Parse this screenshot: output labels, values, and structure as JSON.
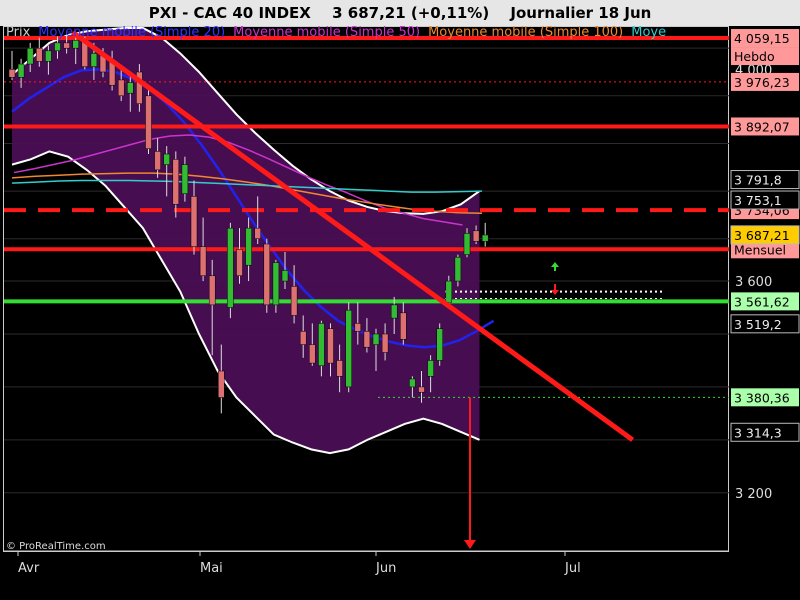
{
  "header": {
    "symbol": "PXI - CAC 40 INDEX",
    "last": "3 687,21 (+0,11%)",
    "period": "Journalier 18 Jun"
  },
  "legend": {
    "items": [
      {
        "label": "Prix",
        "color": "#cccccc"
      },
      {
        "label": "Moyenne mobile (Simple 20)",
        "color": "#3333ff"
      },
      {
        "label": "Moyenne mobile (Simple 50)",
        "color": "#cc33cc"
      },
      {
        "label": "Moyenne mobile (Simple 100)",
        "color": "#ee8833"
      },
      {
        "label": "Moye",
        "color": "#33cccc"
      }
    ]
  },
  "watermark": "© ProRealTime.com",
  "colors": {
    "up": "#33bb33",
    "down": "#dd7070",
    "band_fill": "#4a0f55",
    "mm20": "#2222ee",
    "mm50": "#cc33cc",
    "mm100": "#ee8833",
    "mm200": "#33cccc",
    "resistance": "#ff1a1a",
    "support": "#33dd33"
  },
  "chart_data": {
    "type": "candlestick",
    "title": "PXI - CAC 40 INDEX",
    "x_tick_labels": [
      {
        "label": "Avr",
        "index": 0
      },
      {
        "label": "Mai",
        "index": 20
      },
      {
        "label": "Jun",
        "index": 40
      },
      {
        "label": "Jul",
        "index": 61
      }
    ],
    "y_tick_labels": [
      3200,
      3600,
      4000
    ],
    "ylim": [
      3090,
      4080
    ],
    "ohlc": [
      [
        4000,
        4035,
        3980,
        3985
      ],
      [
        3985,
        4020,
        3965,
        4010
      ],
      [
        4010,
        4050,
        3995,
        4040
      ],
      [
        4040,
        4060,
        4005,
        4015
      ],
      [
        4015,
        4045,
        3990,
        4035
      ],
      [
        4035,
        4062,
        4020,
        4050
      ],
      [
        4050,
        4066,
        4030,
        4040
      ],
      [
        4040,
        4060,
        4010,
        4055
      ],
      [
        4055,
        4062,
        4000,
        4005
      ],
      [
        4005,
        4050,
        3980,
        4030
      ],
      [
        4030,
        4040,
        3985,
        3995
      ],
      [
        4015,
        4035,
        3960,
        3970
      ],
      [
        3980,
        4000,
        3940,
        3950
      ],
      [
        3955,
        3990,
        3920,
        3975
      ],
      [
        3995,
        4010,
        3920,
        3935
      ],
      [
        3950,
        3965,
        3840,
        3850
      ],
      [
        3845,
        3870,
        3795,
        3810
      ],
      [
        3820,
        3855,
        3760,
        3840
      ],
      [
        3830,
        3845,
        3720,
        3745
      ],
      [
        3765,
        3835,
        3750,
        3820
      ],
      [
        3760,
        3790,
        3650,
        3665
      ],
      [
        3665,
        3720,
        3600,
        3610
      ],
      [
        3610,
        3640,
        3460,
        3555
      ],
      [
        3430,
        3480,
        3350,
        3380
      ],
      [
        3550,
        3710,
        3530,
        3700
      ],
      [
        3660,
        3700,
        3595,
        3610
      ],
      [
        3630,
        3720,
        3600,
        3700
      ],
      [
        3700,
        3760,
        3670,
        3680
      ],
      [
        3670,
        3680,
        3540,
        3555
      ],
      [
        3555,
        3640,
        3540,
        3635
      ],
      [
        3600,
        3655,
        3585,
        3620
      ],
      [
        3590,
        3630,
        3520,
        3535
      ],
      [
        3505,
        3535,
        3455,
        3480
      ],
      [
        3480,
        3520,
        3440,
        3445
      ],
      [
        3440,
        3525,
        3420,
        3520
      ],
      [
        3510,
        3520,
        3420,
        3445
      ],
      [
        3450,
        3480,
        3390,
        3420
      ],
      [
        3400,
        3560,
        3390,
        3545
      ],
      [
        3520,
        3560,
        3480,
        3505
      ],
      [
        3505,
        3530,
        3465,
        3475
      ],
      [
        3480,
        3510,
        3430,
        3500
      ],
      [
        3500,
        3520,
        3450,
        3465
      ],
      [
        3530,
        3570,
        3500,
        3555
      ],
      [
        3540,
        3560,
        3480,
        3490
      ],
      [
        3400,
        3420,
        3380,
        3415
      ],
      [
        3400,
        3430,
        3370,
        3390
      ],
      [
        3420,
        3460,
        3390,
        3450
      ],
      [
        3450,
        3520,
        3440,
        3510
      ],
      [
        3560,
        3610,
        3550,
        3600
      ],
      [
        3600,
        3650,
        3590,
        3645
      ],
      [
        3650,
        3700,
        3645,
        3690
      ],
      [
        3695,
        3705,
        3670,
        3675
      ],
      [
        3675,
        3710,
        3665,
        3687
      ]
    ],
    "moving_averages": {
      "Moyenne mobile (Simple 20)": [
        3920,
        3945,
        3965,
        3985,
        3998,
        4000,
        3995,
        3982,
        3962,
        3935,
        3900,
        3858,
        3812,
        3762,
        3712,
        3665,
        3620,
        3582,
        3550,
        3524,
        3508,
        3495,
        3485,
        3478,
        3475,
        3478,
        3488,
        3505,
        3525
      ],
      "Moyenne mobile (Simple 50)": [
        3805,
        3812,
        3820,
        3828,
        3838,
        3848,
        3858,
        3868,
        3874,
        3876,
        3872,
        3862,
        3848,
        3832,
        3815,
        3798,
        3782,
        3768,
        3752,
        3738,
        3728,
        3718,
        3712,
        3706
      ],
      "Moyenne mobile (Simple 100)": [
        3795,
        3798,
        3800,
        3802,
        3803,
        3804,
        3804,
        3802,
        3798,
        3793,
        3787,
        3780,
        3772,
        3764,
        3756,
        3749,
        3742,
        3736,
        3732,
        3729,
        3728
      ],
      "Moye": [
        3785,
        3787,
        3789,
        3790,
        3790,
        3790,
        3789,
        3788,
        3786,
        3784,
        3782,
        3780,
        3778,
        3776,
        3774,
        3772,
        3770,
        3768,
        3768,
        3769,
        3770
      ]
    },
    "bollinger_upper": [
      3990,
      4020,
      4050,
      4065,
      4072,
      4075,
      4078,
      4078,
      4060,
      4030,
      3995,
      3955,
      3915,
      3880,
      3848,
      3818,
      3792,
      3770,
      3752,
      3740,
      3732,
      3728,
      3727,
      3732,
      3745,
      3770
    ],
    "bollinger_lower": [
      3820,
      3830,
      3845,
      3835,
      3810,
      3780,
      3740,
      3700,
      3640,
      3580,
      3500,
      3430,
      3380,
      3345,
      3310,
      3295,
      3282,
      3275,
      3282,
      3300,
      3315,
      3330,
      3340,
      3330,
      3315,
      3300
    ],
    "horizontal_levels": [
      {
        "value": 4059.15,
        "label": "4 059,15",
        "label2": "Hebdo",
        "style": "solid"
      },
      {
        "value": 3976.23,
        "label": "3 976,23",
        "style": "dotted"
      },
      {
        "value": 3892.07,
        "label": "3 892,07",
        "style": "solid"
      },
      {
        "value": 3734.06,
        "label": "3 734,06",
        "style": "dashed"
      },
      {
        "value": 3660.0,
        "label": "Mensuel",
        "style": "solid"
      },
      {
        "value": 3561.62,
        "label": "3 561,62",
        "style": "solid",
        "color": "support"
      },
      {
        "value": 3380.36,
        "label": "3 380,36",
        "style": "dotted",
        "color": "support"
      }
    ],
    "label_boxes": [
      {
        "text": "3 791,8",
        "value": 3791.8
      },
      {
        "text": "3 753,1",
        "value": 3753.1
      },
      {
        "text": "3 687,21",
        "value": 3687.21,
        "highlight": true
      },
      {
        "text": "3 519,2",
        "value": 3519.2
      },
      {
        "text": "3 314,3",
        "value": 3314.3
      }
    ],
    "trendlines": [
      {
        "from": [
          8,
          4070
        ],
        "to": [
          66,
          3300
        ],
        "color": "resistance"
      }
    ],
    "target_arrow": {
      "index": 58,
      "from": 3380,
      "to": 3090
    }
  }
}
